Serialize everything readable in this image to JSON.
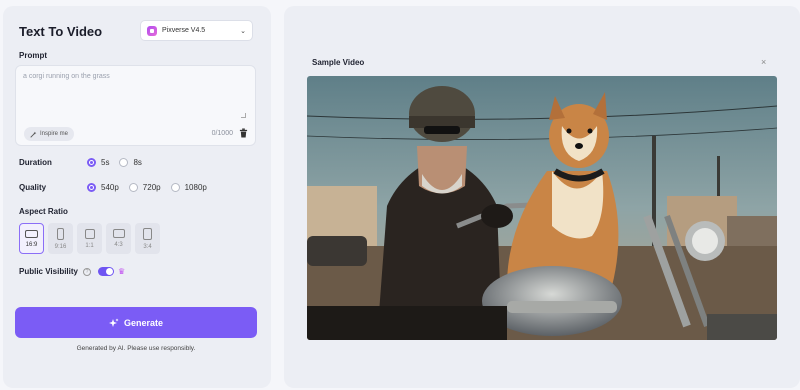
{
  "app": {
    "title": "Text To Video",
    "model": {
      "name": "Pixverse V4.5",
      "icon": "chevron-down-icon"
    }
  },
  "prompt": {
    "label": "Prompt",
    "placeholder": "a corgi running on the grass",
    "inspire_label": "Inspire me",
    "counter": "0/1000"
  },
  "duration": {
    "label": "Duration",
    "options": [
      "5s",
      "8s"
    ],
    "selected": "5s"
  },
  "quality": {
    "label": "Quality",
    "options": [
      "540p",
      "720p",
      "1080p"
    ],
    "selected": "540p"
  },
  "aspect_ratio": {
    "label": "Aspect Ratio",
    "options": [
      "16:9",
      "9:16",
      "1:1",
      "4:3",
      "3:4"
    ],
    "selected": "16:9"
  },
  "visibility": {
    "label": "Public Visibility",
    "enabled": true
  },
  "generate": {
    "label": "Generate",
    "disclaimer": "Generated by AI. Please use responsibly."
  },
  "sample": {
    "title": "Sample Video",
    "close": "×"
  },
  "colors": {
    "accent": "#7b5cf5",
    "panel": "#eceef4"
  }
}
